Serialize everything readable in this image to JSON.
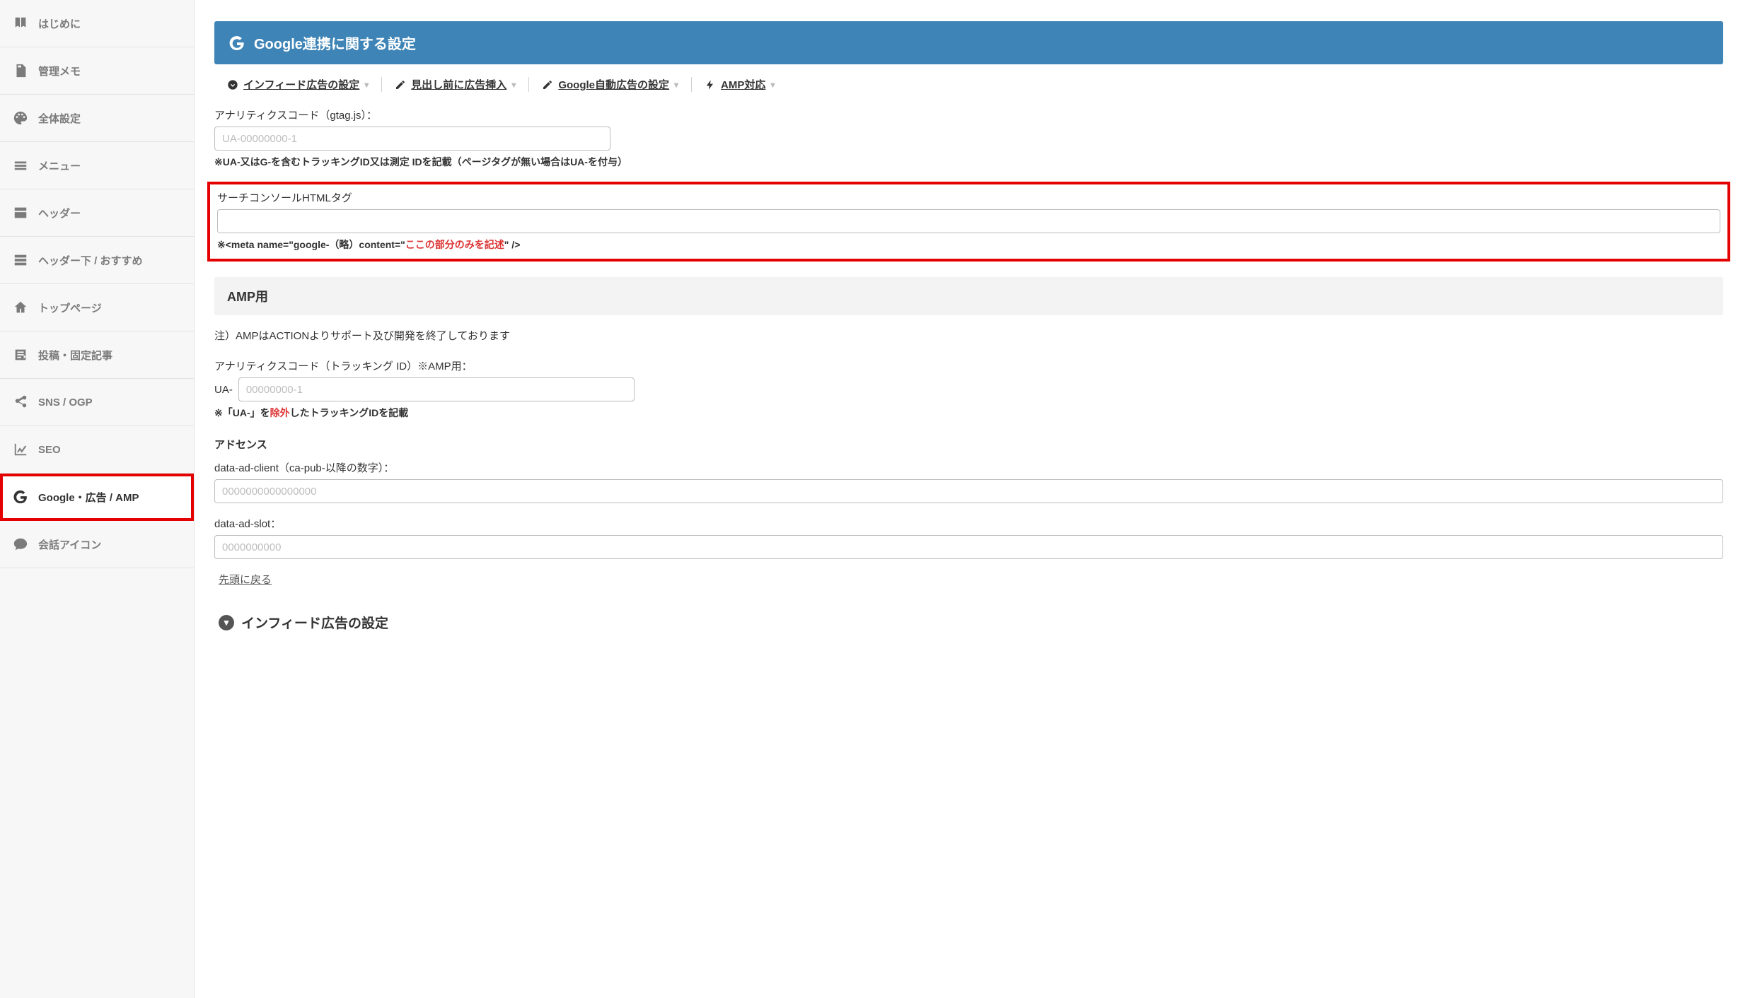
{
  "sidebar": {
    "items": [
      {
        "label": "はじめに"
      },
      {
        "label": "管理メモ"
      },
      {
        "label": "全体設定"
      },
      {
        "label": "メニュー"
      },
      {
        "label": "ヘッダー"
      },
      {
        "label": "ヘッダー下 / おすすめ"
      },
      {
        "label": "トップページ"
      },
      {
        "label": "投稿・固定記事"
      },
      {
        "label": "SNS / OGP"
      },
      {
        "label": "SEO"
      },
      {
        "label": "Google・広告 / AMP"
      },
      {
        "label": "会話アイコン"
      }
    ]
  },
  "banner": {
    "title": "Google連携に関する設定"
  },
  "anchors": {
    "infeed": "インフィード広告の設定",
    "headins": "見出し前に広告挿入",
    "autoad": "Google自動広告の設定",
    "amp": "AMP対応"
  },
  "analytics": {
    "label": "アナリティクスコード（gtag.js）：",
    "placeholder": "UA-00000000-1",
    "note": "※UA-又はG-を含むトラッキングID又は測定 IDを記載（ページタグが無い場合はUA-を付与）"
  },
  "searchconsole": {
    "label": "サーチコンソールHTMLタグ",
    "note_pre": "※<meta name=\"google-（略）content=\"",
    "note_red": "ここの部分のみを記述",
    "note_post": "\"    />"
  },
  "amp_section": {
    "heading": "AMP用",
    "notice": "注）AMPはACTIONよりサポート及び開発を終了しております",
    "label": "アナリティクスコード（トラッキング ID）※AMP用：",
    "prefix": "UA-",
    "placeholder": "00000000-1",
    "note_pre": "※「UA-」を",
    "note_red": "除外",
    "note_post": "したトラッキングIDを記載"
  },
  "adsense": {
    "heading": "アドセンス",
    "client_label": "data-ad-client（ca-pub-以降の数字）：",
    "client_placeholder": "0000000000000000",
    "slot_label": "data-ad-slot：",
    "slot_placeholder": "0000000000"
  },
  "back_top": "先頭に戻る",
  "infeed_banner": "インフィード広告の設定"
}
